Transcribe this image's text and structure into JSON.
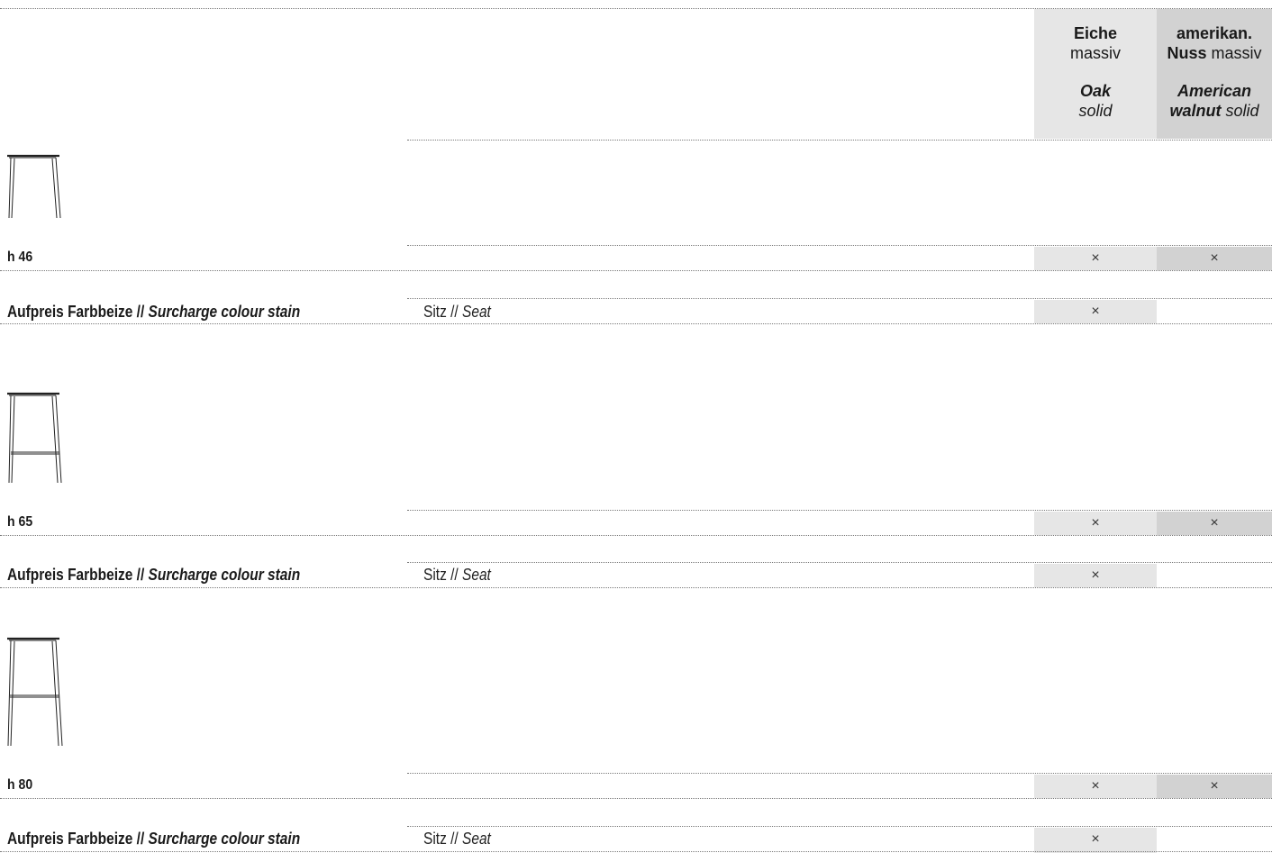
{
  "columns": {
    "oak": {
      "de_name": "Eiche",
      "de_detail": "massiv",
      "en_name": "Oak",
      "en_detail": "solid"
    },
    "walnut": {
      "de_name_line1": "amerikan.",
      "de_name_line2": "Nuss",
      "de_detail": "massiv",
      "en_name_line1": "American",
      "en_name_line2": "walnut",
      "en_detail": "solid"
    }
  },
  "colors": {
    "oak_column": "#e6e6e6",
    "walnut_column": "#d2d2d2",
    "rule": "#7a7a7a"
  },
  "mark": "×",
  "variants": [
    {
      "icon": "bar-stool-h46-icon",
      "height_label": "h 46",
      "oak": "×",
      "walnut": "×",
      "surcharge": {
        "label_de": "Aufpreis Farbbeize // ",
        "label_en": "Surcharge colour stain",
        "part_de": "Sitz // ",
        "part_en": "Seat",
        "oak": "×",
        "walnut": ""
      }
    },
    {
      "icon": "bar-stool-h65-icon",
      "height_label": "h 65",
      "oak": "×",
      "walnut": "×",
      "surcharge": {
        "label_de": "Aufpreis Farbbeize // ",
        "label_en": "Surcharge colour stain",
        "part_de": "Sitz // ",
        "part_en": "Seat",
        "oak": "×",
        "walnut": ""
      }
    },
    {
      "icon": "bar-stool-h80-icon",
      "height_label": "h 80",
      "oak": "×",
      "walnut": "×",
      "surcharge": {
        "label_de": "Aufpreis Farbbeize // ",
        "label_en": "Surcharge colour stain",
        "part_de": "Sitz // ",
        "part_en": "Seat",
        "oak": "×",
        "walnut": ""
      }
    }
  ]
}
